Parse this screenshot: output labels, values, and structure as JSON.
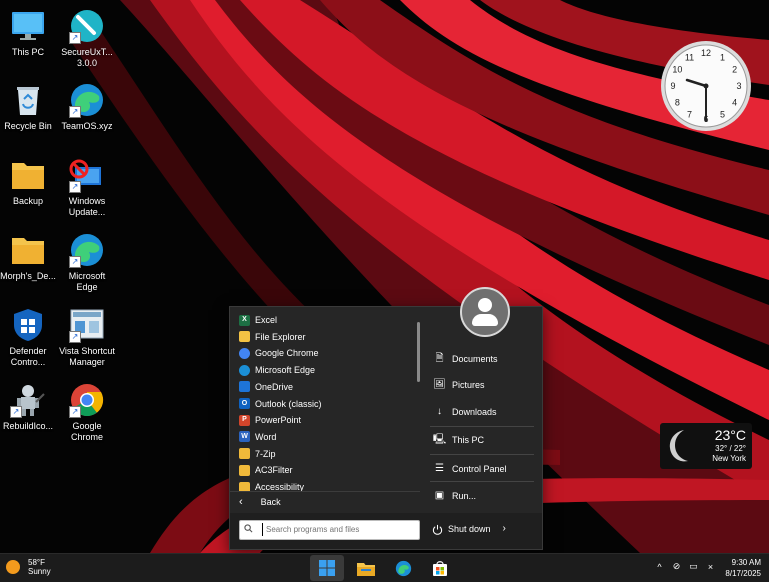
{
  "desktop": {
    "icons": [
      {
        "label": "This PC",
        "icon": "monitor-icon"
      },
      {
        "label": "SecureUxT...\n3.0.0",
        "icon": "screwdriver-icon"
      },
      {
        "label": "Recycle Bin",
        "icon": "recycle-bin-icon"
      },
      {
        "label": "TeamOS.xyz",
        "icon": "edge-icon"
      },
      {
        "label": "Backup",
        "icon": "folder-icon"
      },
      {
        "label": "Windows\nUpdate...",
        "icon": "windows-update-icon"
      },
      {
        "label": "Morph's_De...",
        "icon": "folder-icon"
      },
      {
        "label": "Microsoft\nEdge",
        "icon": "edge-icon"
      },
      {
        "label": "Defender\nContro...",
        "icon": "shield-icon"
      },
      {
        "label": "Vista Shortcut\nManager",
        "icon": "shortcut-manager-icon"
      },
      {
        "label": "RebuildIco...",
        "icon": "robot-icon"
      },
      {
        "label": "Google\nChrome",
        "icon": "chrome-icon"
      }
    ]
  },
  "clock": {
    "numbers": [
      "12",
      "1",
      "2",
      "3",
      "4",
      "5",
      "6",
      "7",
      "8",
      "9",
      "10",
      "11"
    ]
  },
  "weather_widget": {
    "temp": "23°C",
    "range": "32° / 22°",
    "city": "New York"
  },
  "start_menu": {
    "programs": [
      {
        "label": "Excel",
        "icon": "excel-icon",
        "color": "#1d7044",
        "glyph": "X"
      },
      {
        "label": "File Explorer",
        "icon": "file-explorer-icon",
        "color": "#f3c244",
        "glyph": ""
      },
      {
        "label": "Google Chrome",
        "icon": "chrome-icon",
        "color": "#4285f4",
        "glyph": ""
      },
      {
        "label": "Microsoft Edge",
        "icon": "edge-icon",
        "color": "#1b8fd6",
        "glyph": ""
      },
      {
        "label": "OneDrive",
        "icon": "onedrive-icon",
        "color": "#1e74d8",
        "glyph": ""
      },
      {
        "label": "Outlook (classic)",
        "icon": "outlook-icon",
        "color": "#0f62c1",
        "glyph": "O"
      },
      {
        "label": "PowerPoint",
        "icon": "powerpoint-icon",
        "color": "#d2452b",
        "glyph": "P"
      },
      {
        "label": "Word",
        "icon": "word-icon",
        "color": "#2b63be",
        "glyph": "W"
      },
      {
        "label": "7-Zip",
        "icon": "folder-icon",
        "color": "#f0b93a",
        "glyph": ""
      },
      {
        "label": "AC3Filter",
        "icon": "folder-icon",
        "color": "#f0b93a",
        "glyph": ""
      },
      {
        "label": "Accessibility",
        "icon": "folder-icon",
        "color": "#f0b93a",
        "glyph": ""
      }
    ],
    "back_label": "Back",
    "right_links": [
      {
        "label": "Documents",
        "icon": "document-icon",
        "glyph": "🗎"
      },
      {
        "label": "Pictures",
        "icon": "picture-icon",
        "glyph": "🖼"
      },
      {
        "label": "Downloads",
        "icon": "download-icon",
        "glyph": "↓"
      },
      {
        "label": "This PC",
        "icon": "computer-icon",
        "glyph": "🖳"
      },
      {
        "label": "Control Panel",
        "icon": "control-panel-icon",
        "glyph": "☰"
      },
      {
        "label": "Run...",
        "icon": "run-icon",
        "glyph": "▣"
      }
    ],
    "search_placeholder": "Search programs and files",
    "shutdown_label": "Shut down"
  },
  "taskbar": {
    "weather_temp": "58°F",
    "weather_desc": "Sunny",
    "time": "9:30 AM",
    "date": "8/17/2025",
    "tray_icons": [
      "chevron-up-icon",
      "wifi-off-icon",
      "display-icon",
      "mute-icon"
    ]
  }
}
